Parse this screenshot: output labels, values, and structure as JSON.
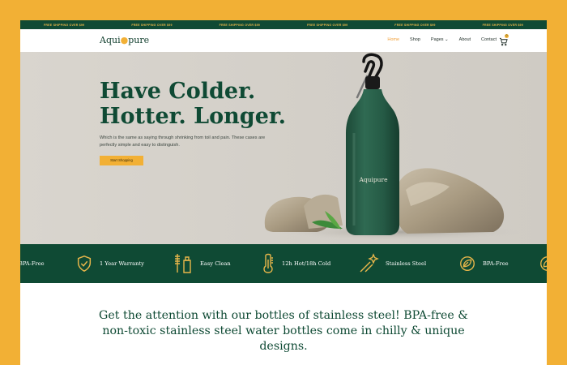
{
  "topbar": {
    "messages": [
      "FREE SHIPPING OVER $99",
      "FREE SHIPPING OVER $99",
      "FREE SHIPPING OVER $99",
      "FREE SHIPPING OVER $99",
      "FREE SHIPPING OVER $99",
      "FREE SHIPPING OVER $99"
    ]
  },
  "nav": {
    "logo_left": "Aqui",
    "logo_right": "pure",
    "items": [
      "Home",
      "Shop",
      "Pages",
      "About",
      "Contact"
    ],
    "cart_count": "0"
  },
  "hero": {
    "title_line1": "Have Colder.",
    "title_line2": "Hotter. Longer.",
    "description": "Which is the same as saying through shrinking from toil and pain. These cases are perfectly simple and easy to distinguish.",
    "button_label": "Start Shopping",
    "bottle_logo": "Aquipure"
  },
  "features": [
    {
      "label": "BPA-Free",
      "icon": "leaf-icon"
    },
    {
      "label": "1 Year Warranty",
      "icon": "shield-check-icon"
    },
    {
      "label": "Easy Clean",
      "icon": "brush-bottle-icon"
    },
    {
      "label": "12h Hot/18h Cold",
      "icon": "thermometer-icon"
    },
    {
      "label": "Stainless Steel",
      "icon": "sparkle-wand-icon"
    },
    {
      "label": "BPA-Free",
      "icon": "leaf-icon"
    }
  ],
  "promo": {
    "text": "Get the attention with our bottles of stainless steel! BPA-free & non-toxic stainless steel water bottles come in chilly & unique designs."
  },
  "colors": {
    "frame": "#f2b035",
    "brand_green": "#0f4a34",
    "accent": "#f2b035"
  }
}
